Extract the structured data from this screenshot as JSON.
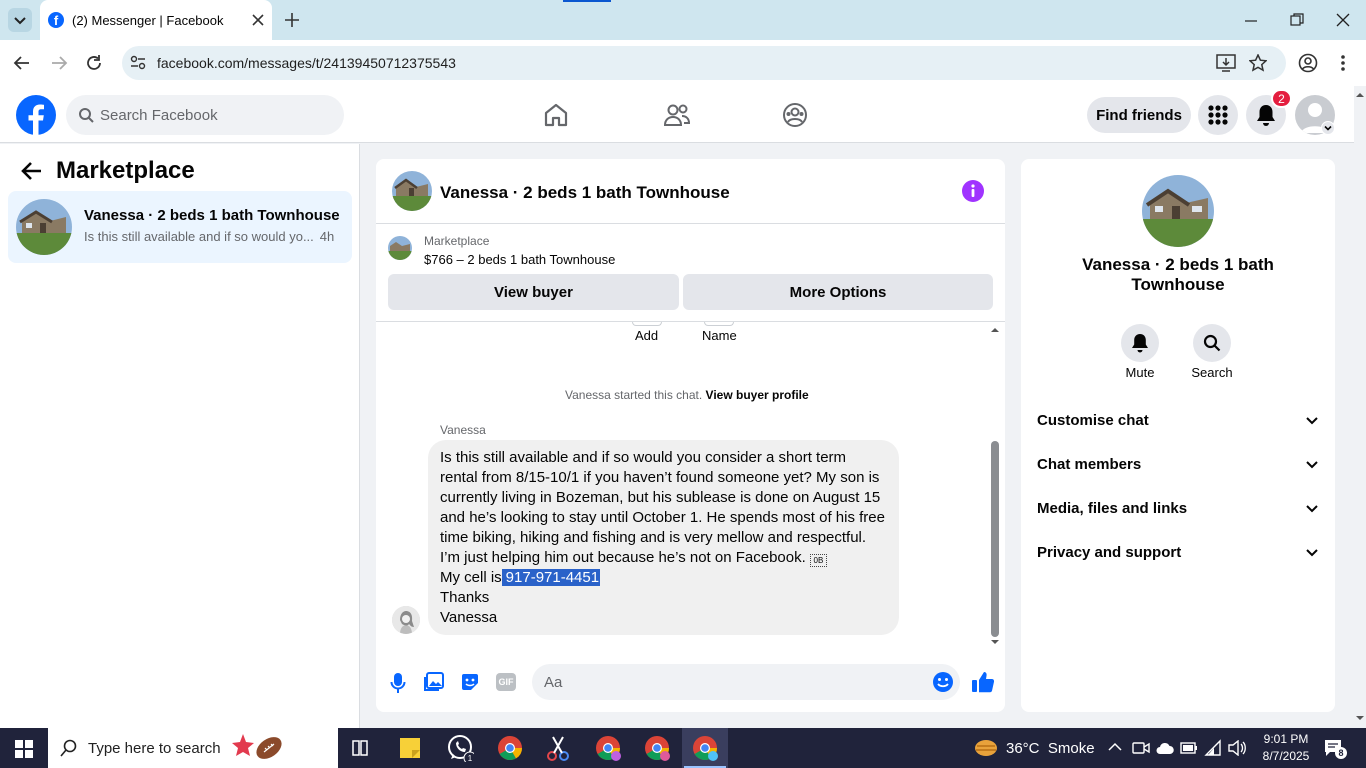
{
  "browser": {
    "tab_title": "(2) Messenger | Facebook",
    "url": "facebook.com/messages/t/24139450712375543"
  },
  "fb": {
    "search_placeholder": "Search Facebook",
    "find_friends": "Find friends",
    "notification_count": "2"
  },
  "left": {
    "title": "Marketplace",
    "thread": {
      "title": "Vanessa · 2 beds 1 bath Townhouse",
      "preview": "Is this still available and if so would yo...",
      "time": "4h"
    }
  },
  "chat": {
    "title": "Vanessa · 2 beds 1 bath Townhouse",
    "listing_label": "Marketplace",
    "listing_price": "$766 – 2 beds 1 bath Townhouse",
    "view_buyer": "View buyer",
    "more_options": "More Options",
    "add_label": "Add",
    "name_label": "Name",
    "started_text": "Vanessa started this chat.",
    "view_buyer_profile": "View buyer profile",
    "sender": "Vanessa",
    "message_lines": [
      "Is this still available and if so would you consider a short term",
      "rental from 8/15-10/1 if you haven’t found someone yet? My son is",
      "currently living in Bozeman, but his sublease is done on August 15",
      "and he’s looking to stay until October 1. He spends most of his free",
      "time biking, hiking and fishing and is very mellow and respectful.",
      "I’m just helping him out because he’s not on Facebook. "
    ],
    "cell_prefix": "My cell is",
    "cell_number": "917-971-4451",
    "thanks": "Thanks",
    "signature": "Vanessa",
    "composer_placeholder": "Aa"
  },
  "info": {
    "name": "Vanessa · 2 beds 1 bath Townhouse",
    "mute": "Mute",
    "search": "Search",
    "sections": [
      "Customise chat",
      "Chat members",
      "Media, files and links",
      "Privacy and support"
    ]
  },
  "taskbar": {
    "search_placeholder": "Type here to search",
    "weather": "36°C  Smoke",
    "time": "9:01 PM",
    "date": "8/7/2025",
    "notif": "8"
  },
  "colors": {
    "fb_blue": "#0866ff",
    "messenger_purple": "#a033ff",
    "selection": "#2a62c9"
  }
}
